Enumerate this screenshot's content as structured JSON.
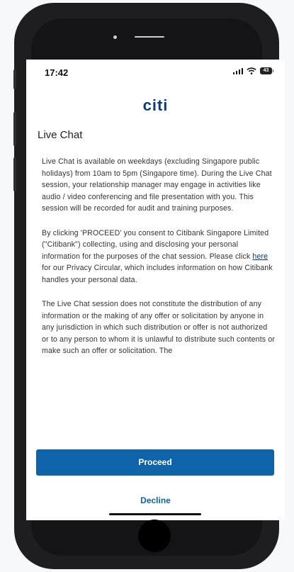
{
  "status_bar": {
    "time": "17:42",
    "battery": "43",
    "icons": [
      "signal-icon",
      "wifi-icon",
      "battery-icon"
    ]
  },
  "brand": {
    "logo_text": "citi",
    "color": "#0b3a7e"
  },
  "page": {
    "title": "Live Chat"
  },
  "paragraphs": {
    "p1": "Live Chat is available on weekdays (excluding Singapore public holidays) from 10am to 5pm (Singapore time). During the Live Chat session, your relationship manager may engage in activities like audio / video conferencing and file presentation with you. This session will be recorded for audit and training purposes.",
    "p2_before_link": "By clicking 'PROCEED' you consent to Citibank Singapore Limited (\"Citibank\") collecting, using and disclosing your personal information for the purposes of the chat session. Please click ",
    "p2_link": "here",
    "p2_after_link": " for our Privacy Circular, which includes information on how Citibank handles your personal data.",
    "p3": "The Live Chat session does not constitute the distribution of any information or the making of any offer or solicitation by anyone in any jurisdiction in which such distribution or offer is not authorized or to any person to whom it is unlawful to distribute such contents or make such an offer or solicitation. The"
  },
  "actions": {
    "proceed_label": "Proceed",
    "decline_label": "Decline",
    "accent_color": "#0f63a8"
  }
}
